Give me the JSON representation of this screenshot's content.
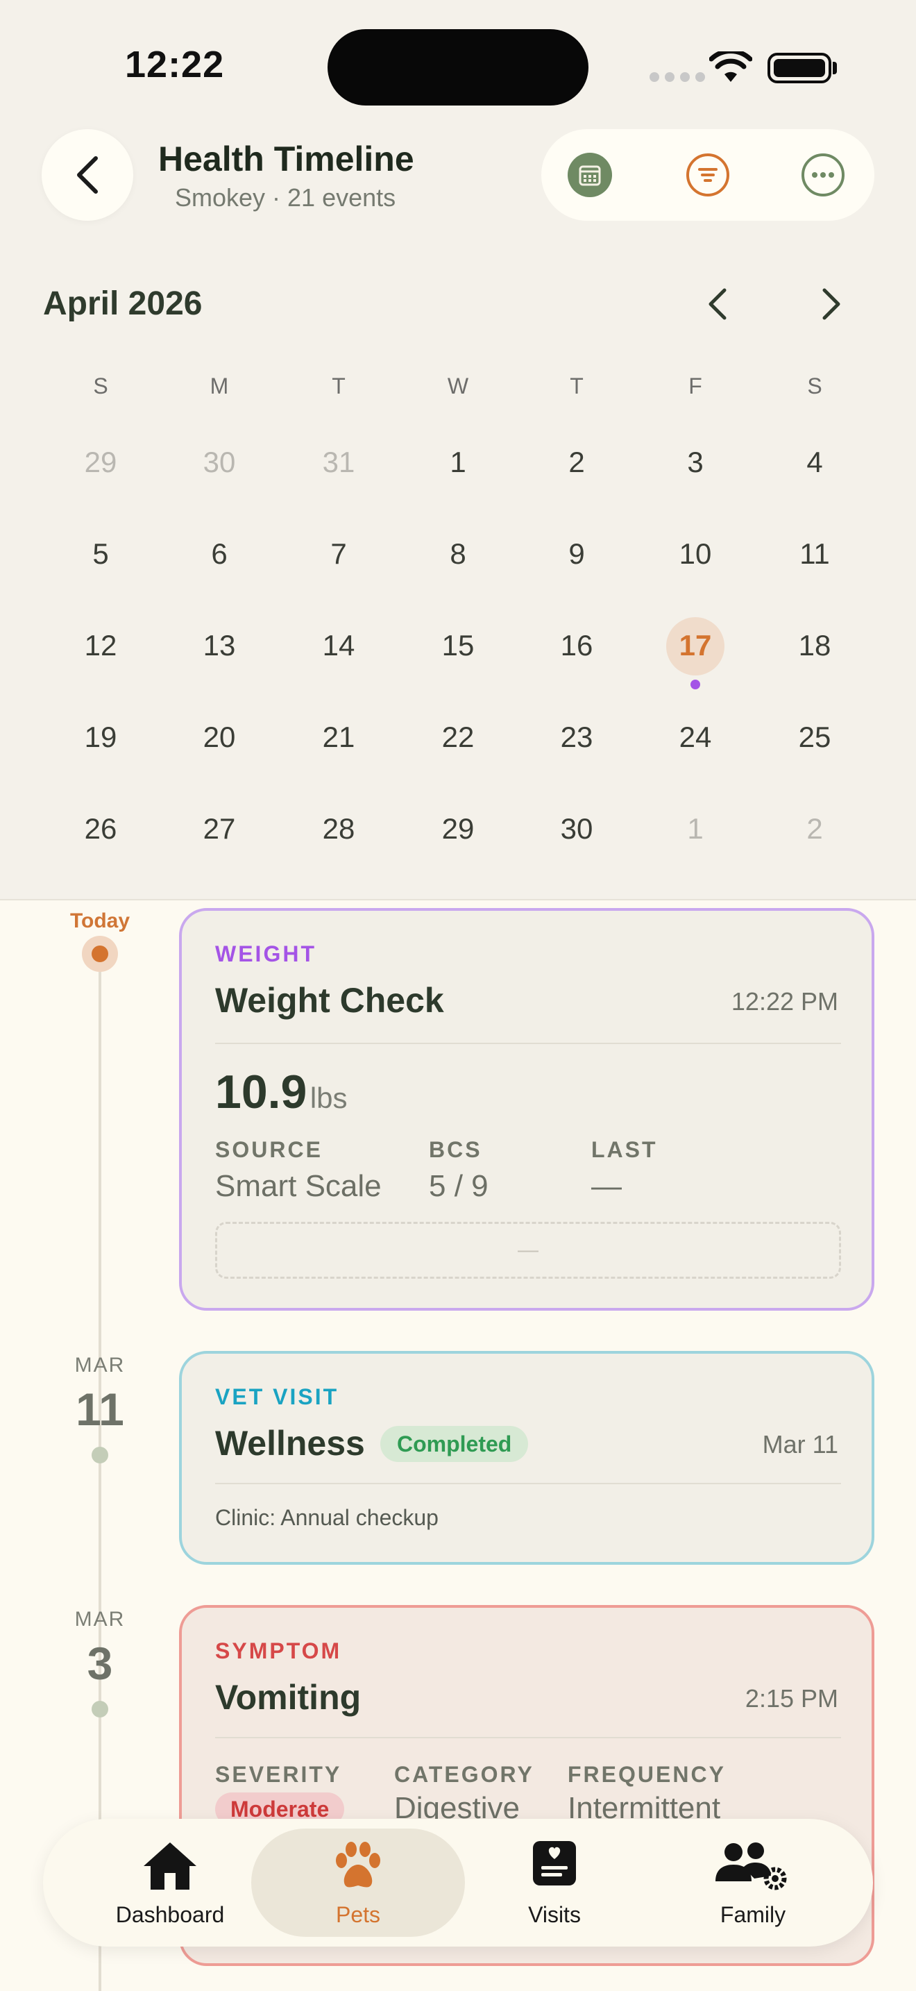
{
  "status": {
    "time": "12:22"
  },
  "header": {
    "title": "Health Timeline",
    "subtitle": "Smokey · 21 events"
  },
  "calendar": {
    "month": "April 2026",
    "weekdays": [
      "S",
      "M",
      "T",
      "W",
      "T",
      "F",
      "S"
    ],
    "weeks": [
      [
        "29",
        "30",
        "31",
        "1",
        "2",
        "3",
        "4"
      ],
      [
        "5",
        "6",
        "7",
        "8",
        "9",
        "10",
        "11"
      ],
      [
        "12",
        "13",
        "14",
        "15",
        "16",
        "17",
        "18"
      ],
      [
        "19",
        "20",
        "21",
        "22",
        "23",
        "24",
        "25"
      ],
      [
        "26",
        "27",
        "28",
        "29",
        "30",
        "1",
        "2"
      ]
    ],
    "selected": "17"
  },
  "timeline": {
    "today_label": "Today",
    "groups": [
      {
        "month": "MAR",
        "day": "11"
      },
      {
        "month": "MAR",
        "day": "3"
      }
    ]
  },
  "cards": {
    "weight": {
      "category": "WEIGHT",
      "title": "Weight Check",
      "time": "12:22 PM",
      "value": "10.9",
      "unit": "lbs",
      "source_label": "SOURCE",
      "source_value": "Smart Scale",
      "bcs_label": "BCS",
      "bcs_value": "5 / 9",
      "last_label": "LAST",
      "last_value": "—",
      "placeholder": "—",
      "color": "#c9a8ee"
    },
    "vet": {
      "category": "VET VISIT",
      "title": "Wellness",
      "badge": "Completed",
      "time": "Mar 11",
      "clinic": "Clinic: Annual checkup",
      "color": "#9dd4dd"
    },
    "symptom": {
      "category": "SYMPTOM",
      "title": "Vomiting",
      "time": "2:15 PM",
      "severity_label": "SEVERITY",
      "severity_value": "Moderate",
      "category_label": "CATEGORY",
      "category_value": "Digestive",
      "frequency_label": "FREQUENCY",
      "frequency_value": "Intermittent",
      "color": "#ee9c95"
    }
  },
  "tabs": [
    {
      "label": "Dashboard",
      "icon": "home-icon"
    },
    {
      "label": "Pets",
      "icon": "paw-icon"
    },
    {
      "label": "Visits",
      "icon": "medical-record-icon"
    },
    {
      "label": "Family",
      "icon": "family-settings-icon"
    }
  ],
  "colors": {
    "accent": "#d4742f",
    "weight": "#a454e6",
    "vet": "#1aa3c2",
    "symptom": "#d64848"
  }
}
